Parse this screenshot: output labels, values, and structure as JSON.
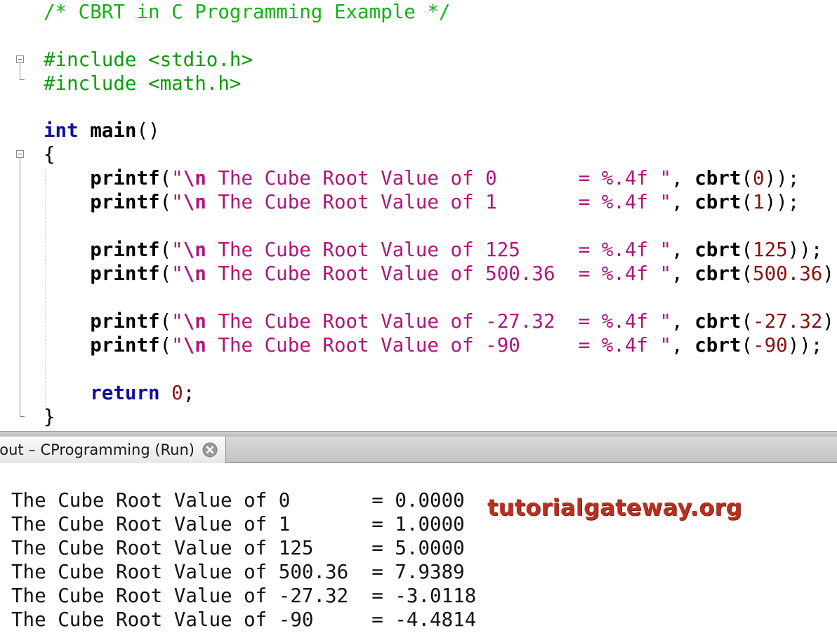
{
  "editor": {
    "lines": [
      [
        [
          "comment",
          "/* CBRT in C Programming Example */"
        ]
      ],
      [],
      [
        [
          "pre",
          "#include <stdio.h>"
        ]
      ],
      [
        [
          "pre",
          "#include <math.h>"
        ]
      ],
      [],
      [
        [
          "kw",
          "int"
        ],
        [
          "punct",
          " "
        ],
        [
          "fn",
          "main"
        ],
        [
          "punct",
          "()"
        ]
      ],
      [
        [
          "punct",
          "{"
        ]
      ],
      [
        [
          "punct",
          "    "
        ],
        [
          "fn",
          "printf"
        ],
        [
          "punct",
          "("
        ],
        [
          "str",
          "\""
        ],
        [
          "esc",
          "\\n"
        ],
        [
          "str",
          " The Cube Root Value of 0       = %.4f \""
        ],
        [
          "punct",
          ", "
        ],
        [
          "fn",
          "cbrt"
        ],
        [
          "punct",
          "("
        ],
        [
          "num",
          "0"
        ],
        [
          "punct",
          "));"
        ]
      ],
      [
        [
          "punct",
          "    "
        ],
        [
          "fn",
          "printf"
        ],
        [
          "punct",
          "("
        ],
        [
          "str",
          "\""
        ],
        [
          "esc",
          "\\n"
        ],
        [
          "str",
          " The Cube Root Value of 1       = %.4f \""
        ],
        [
          "punct",
          ", "
        ],
        [
          "fn",
          "cbrt"
        ],
        [
          "punct",
          "("
        ],
        [
          "num",
          "1"
        ],
        [
          "punct",
          "));"
        ]
      ],
      [],
      [
        [
          "punct",
          "    "
        ],
        [
          "fn",
          "printf"
        ],
        [
          "punct",
          "("
        ],
        [
          "str",
          "\""
        ],
        [
          "esc",
          "\\n"
        ],
        [
          "str",
          " The Cube Root Value of 125     = %.4f \""
        ],
        [
          "punct",
          ", "
        ],
        [
          "fn",
          "cbrt"
        ],
        [
          "punct",
          "("
        ],
        [
          "num",
          "125"
        ],
        [
          "punct",
          "));"
        ]
      ],
      [
        [
          "punct",
          "    "
        ],
        [
          "fn",
          "printf"
        ],
        [
          "punct",
          "("
        ],
        [
          "str",
          "\""
        ],
        [
          "esc",
          "\\n"
        ],
        [
          "str",
          " The Cube Root Value of 500.36  = %.4f \""
        ],
        [
          "punct",
          ", "
        ],
        [
          "fn",
          "cbrt"
        ],
        [
          "punct",
          "("
        ],
        [
          "num",
          "500.36"
        ],
        [
          "punct",
          "));"
        ]
      ],
      [],
      [
        [
          "punct",
          "    "
        ],
        [
          "fn",
          "printf"
        ],
        [
          "punct",
          "("
        ],
        [
          "str",
          "\""
        ],
        [
          "esc",
          "\\n"
        ],
        [
          "str",
          " The Cube Root Value of -27.32  = %.4f \""
        ],
        [
          "punct",
          ", "
        ],
        [
          "fn",
          "cbrt"
        ],
        [
          "punct",
          "("
        ],
        [
          "num",
          "-27.32"
        ],
        [
          "punct",
          "));"
        ]
      ],
      [
        [
          "punct",
          "    "
        ],
        [
          "fn",
          "printf"
        ],
        [
          "punct",
          "("
        ],
        [
          "str",
          "\""
        ],
        [
          "esc",
          "\\n"
        ],
        [
          "str",
          " The Cube Root Value of -90     = %.4f \""
        ],
        [
          "punct",
          ", "
        ],
        [
          "fn",
          "cbrt"
        ],
        [
          "punct",
          "("
        ],
        [
          "num",
          "-90"
        ],
        [
          "punct",
          "));"
        ]
      ],
      [],
      [
        [
          "punct",
          "    "
        ],
        [
          "kw",
          "return"
        ],
        [
          "punct",
          " "
        ],
        [
          "num",
          "0"
        ],
        [
          "punct",
          ";"
        ]
      ],
      [
        [
          "punct",
          "}"
        ]
      ]
    ]
  },
  "output_tab": {
    "label": "out – CProgramming (Run)"
  },
  "output": {
    "lines": [
      "The Cube Root Value of 0       = 0.0000",
      "The Cube Root Value of 1       = 1.0000",
      "The Cube Root Value of 125     = 5.0000",
      "The Cube Root Value of 500.36  = 7.9389",
      "The Cube Root Value of -27.32  = -3.0118",
      "The Cube Root Value of -90     = -4.4814"
    ]
  },
  "watermark": "tutorialgateway.org",
  "colors": {
    "comment": "#13b313",
    "preprocessor": "#0f9a0f",
    "keyword": "#0e0ea0",
    "string": "#b0157c",
    "number": "#8b0f0f",
    "watermark": "#b83022"
  }
}
